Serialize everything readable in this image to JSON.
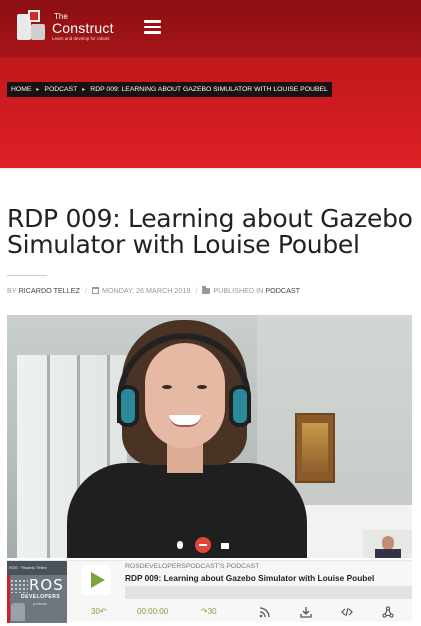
{
  "header": {
    "logo_the": "The",
    "logo_name": "Construct",
    "logo_tagline": "Learn and develop for robots",
    "menu_icon": "hamburger-menu-icon"
  },
  "breadcrumb": {
    "home": "HOME",
    "category": "PODCAST",
    "current": "RDP 009: LEARNING ABOUT GAZEBO SIMULATOR WITH LOUISE POUBEL",
    "separator": "▸"
  },
  "post": {
    "title": "RDP 009: Learning about Gazebo Simulator with Louise Poubel",
    "meta": {
      "by_label": "BY",
      "author": "RICARDO TELLEZ",
      "separator": "/",
      "date": "MONDAY, 26 MARCH 2018",
      "published_label": "PUBLISHED IN",
      "category": "PODCAST"
    }
  },
  "player": {
    "cover": {
      "top_text": "ROS · Ricardo Téllez",
      "ros": "ROS",
      "developers": "DEVELOPERS",
      "podcast": "podcast"
    },
    "podcast_name": "ROSDEVELOPERSPODCAST'S PODCAST",
    "episode_title": "RDP 009: Learning about Gazebo Simulator with Louise Poubel",
    "progress_fraction": 0,
    "rewind_label": "30",
    "time": "00:00:00",
    "forward_label": "30",
    "accent_color": "#7fa33b",
    "icons": [
      "rss-icon",
      "download-icon",
      "embed-code-icon",
      "share-icon"
    ]
  },
  "colors": {
    "hero_red": "#c51a1d",
    "breadcrumb_bg": "#1a1212",
    "title_text": "#222222"
  }
}
